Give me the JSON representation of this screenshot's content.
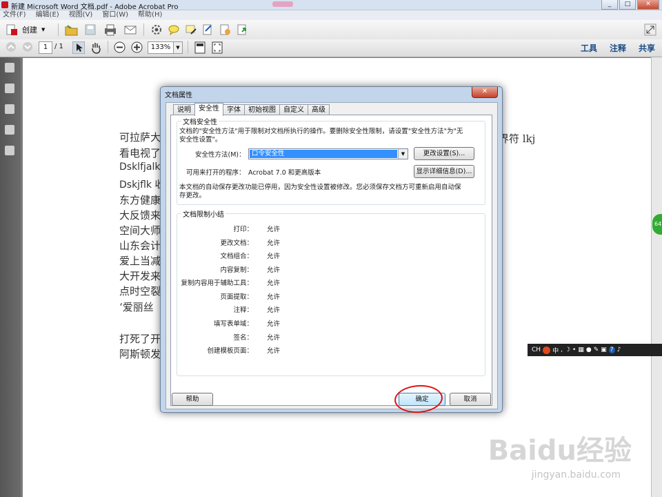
{
  "window": {
    "title": "新建 Microsoft Word 文档.pdf - Adobe Acrobat Pro",
    "controls": [
      "_",
      "□",
      "✕"
    ]
  },
  "menu": [
    "文件(F)",
    "编辑(E)",
    "视图(V)",
    "窗口(W)",
    "帮助(H)"
  ],
  "toolbar": {
    "create_label": "创建",
    "page_current": "1",
    "page_total": "/ 1",
    "zoom": "133%",
    "right_links": [
      "工具",
      "注释",
      "共享"
    ]
  },
  "document": {
    "lines": [
      "可拉萨大",
      "看电视了",
      "Dsklfjalkd",
      "Dskjflk 收",
      "东方健康",
      "大反馈来",
      "空间大师",
      "山东会计",
      "爱上当减",
      "大开发来",
      "点时空裂",
      "‘爱丽丝",
      "打死了开",
      "阿斯顿发"
    ],
    "right_text": "界符 lkj"
  },
  "dialog": {
    "title": "文档属性",
    "close": "✕",
    "tabs": [
      "说明",
      "安全性",
      "字体",
      "初始视图",
      "自定义",
      "高级"
    ],
    "active_tab": "安全性",
    "security": {
      "group_title": "文档安全性",
      "desc1": "文档的\"安全性方法\"用于限制对文档所执行的操作。要删除安全性限制，请设置\"安全性方法\"为\"无",
      "desc2": "安全性设置\"。",
      "method_label": "安全性方法(M)：",
      "method_value": "口令安全性",
      "change_btn": "更改设置(S)...",
      "app_label": "可用来打开的程序：",
      "app_value": "Acrobat 7.0 和更高版本",
      "details_btn": "显示详细信息(D)...",
      "note1": "本文档的自动保存更改功能已停用，因为安全性设置被修改。您必须保存文档方可重新启用自动保",
      "note2": "存更改。"
    },
    "restrictions": {
      "group_title": "文档限制小结",
      "items": [
        {
          "label": "打印：",
          "value": "允许"
        },
        {
          "label": "更改文档：",
          "value": "允许"
        },
        {
          "label": "文档组合：",
          "value": "允许"
        },
        {
          "label": "内容复制：",
          "value": "允许"
        },
        {
          "label": "复制内容用于辅助工具：",
          "value": "允许"
        },
        {
          "label": "页面提取：",
          "value": "允许"
        },
        {
          "label": "注释：",
          "value": "允许"
        },
        {
          "label": "填写表单域：",
          "value": "允许"
        },
        {
          "label": "签名：",
          "value": "允许"
        },
        {
          "label": "创建模板页面：",
          "value": "允许"
        }
      ]
    },
    "buttons": {
      "help": "帮助",
      "ok": "确定",
      "cancel": "取消"
    }
  },
  "ime_bar": {
    "label": "CH",
    "mode": "中"
  },
  "side_bubble": "64",
  "watermark": {
    "main": "Baidu经验",
    "sub": "jingyan.baidu.com"
  },
  "colors": {
    "accent": "#3390ff",
    "annotation": "#dd1111",
    "link": "#1b4d86"
  }
}
